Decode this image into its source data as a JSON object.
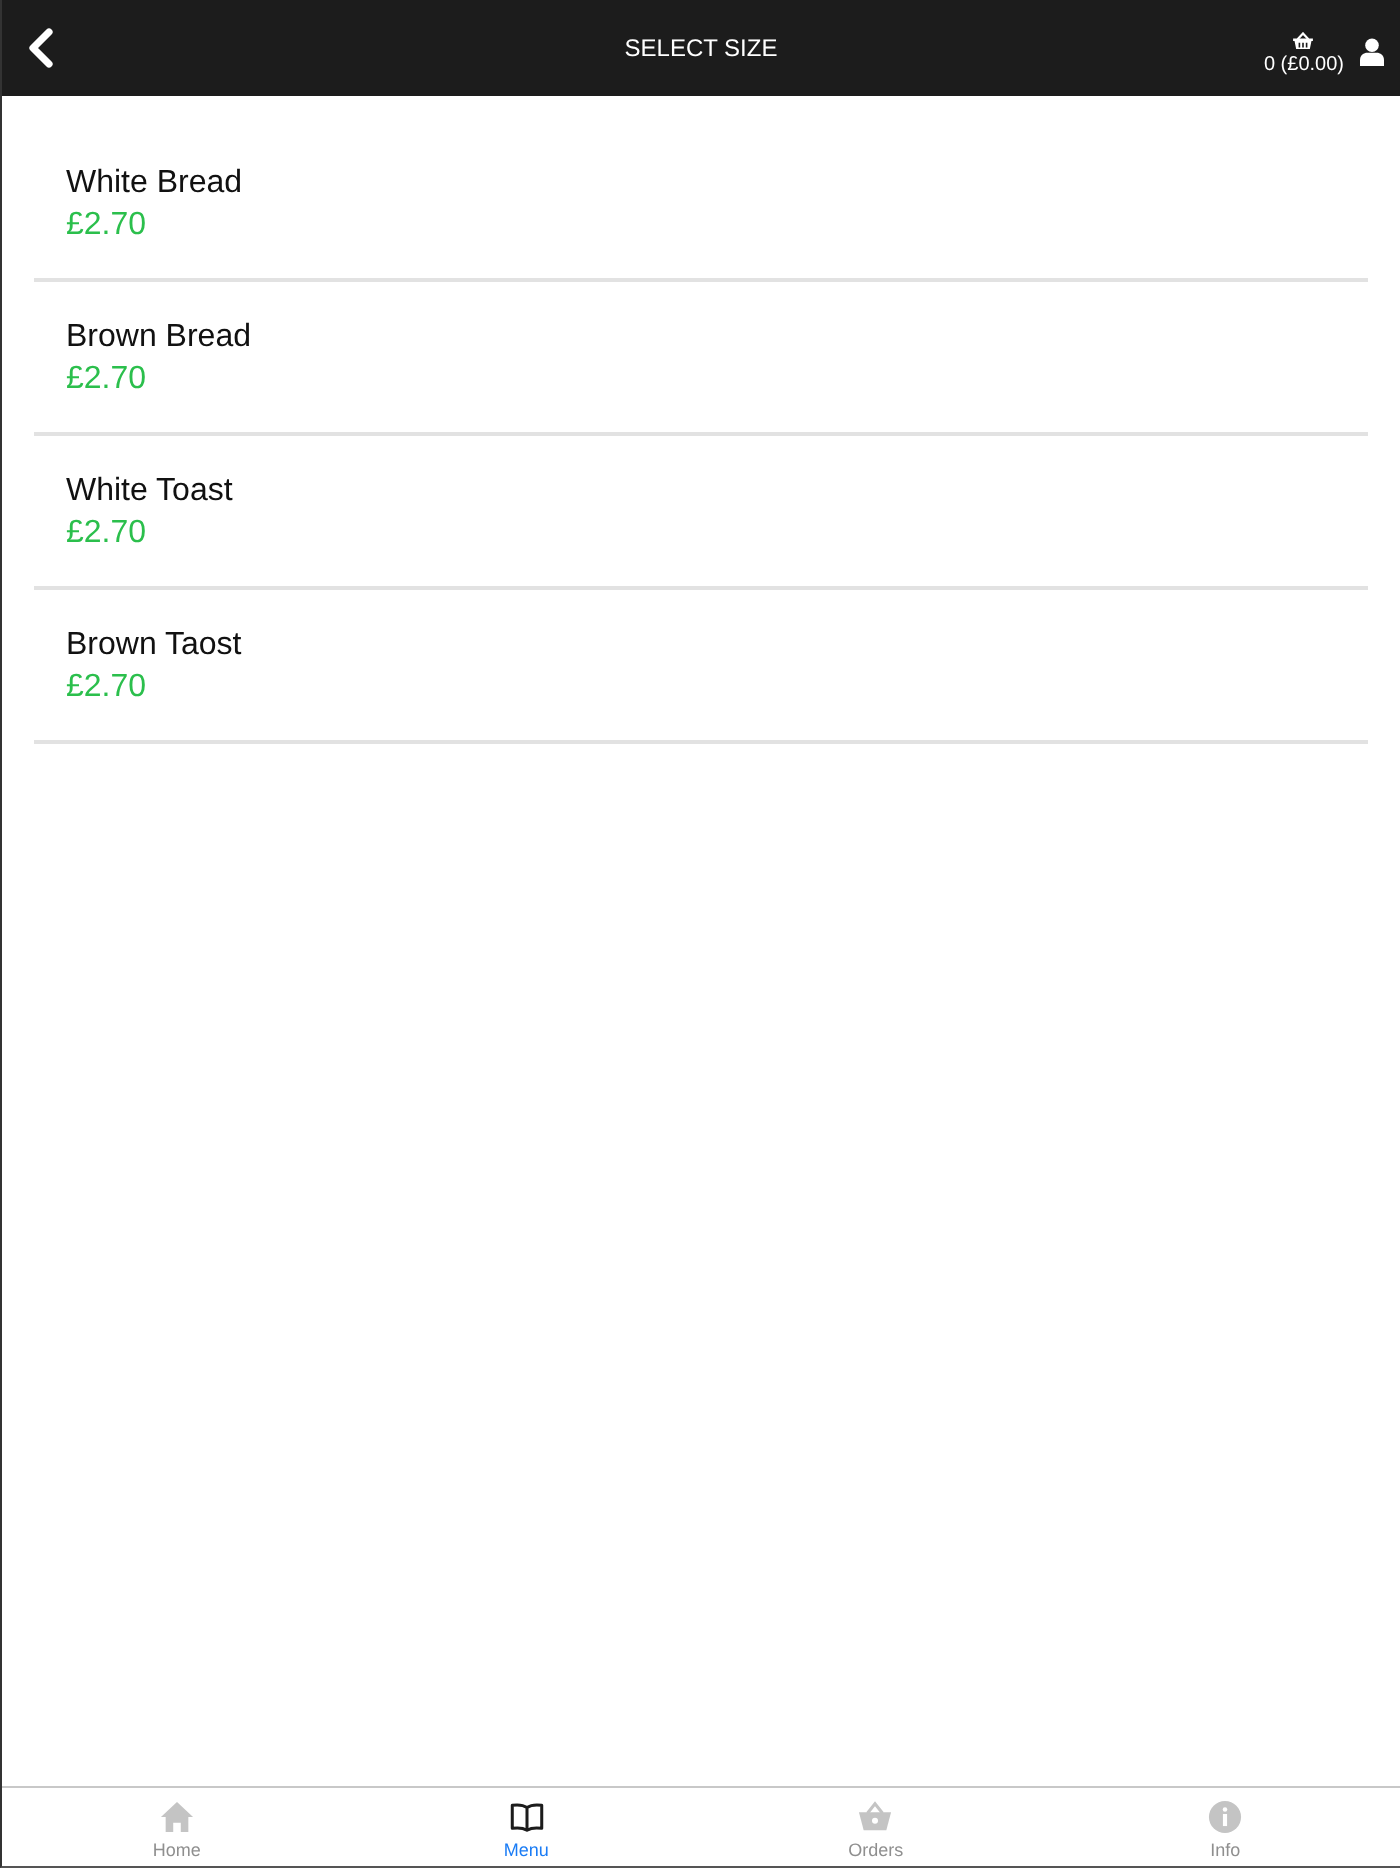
{
  "header": {
    "title": "SELECT SIZE",
    "cart_summary": "0 (£0.00)"
  },
  "items": [
    {
      "name": "White Bread",
      "price": "£2.70"
    },
    {
      "name": "Brown Bread",
      "price": "£2.70"
    },
    {
      "name": "White Toast",
      "price": "£2.70"
    },
    {
      "name": "Brown Taost",
      "price": "£2.70"
    }
  ],
  "tab_bar": [
    {
      "label": "Home",
      "kind": "home",
      "selected": false
    },
    {
      "label": "Menu",
      "kind": "menu",
      "selected": true
    },
    {
      "label": "Orders",
      "kind": "orders",
      "selected": false
    },
    {
      "label": "Info",
      "kind": "info",
      "selected": false
    }
  ]
}
